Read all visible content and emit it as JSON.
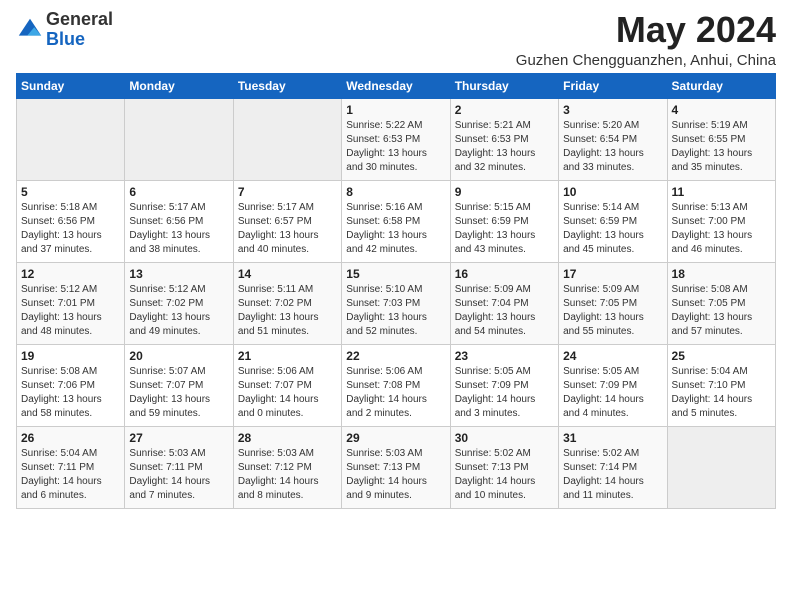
{
  "logo": {
    "general": "General",
    "blue": "Blue"
  },
  "title": "May 2024",
  "location": "Guzhen Chengguanzhen, Anhui, China",
  "days_of_week": [
    "Sunday",
    "Monday",
    "Tuesday",
    "Wednesday",
    "Thursday",
    "Friday",
    "Saturday"
  ],
  "weeks": [
    [
      {
        "day": "",
        "empty": true
      },
      {
        "day": "",
        "empty": true
      },
      {
        "day": "",
        "empty": true
      },
      {
        "day": "1",
        "sunrise": "5:22 AM",
        "sunset": "6:53 PM",
        "daylight": "13 hours and 30 minutes."
      },
      {
        "day": "2",
        "sunrise": "5:21 AM",
        "sunset": "6:53 PM",
        "daylight": "13 hours and 32 minutes."
      },
      {
        "day": "3",
        "sunrise": "5:20 AM",
        "sunset": "6:54 PM",
        "daylight": "13 hours and 33 minutes."
      },
      {
        "day": "4",
        "sunrise": "5:19 AM",
        "sunset": "6:55 PM",
        "daylight": "13 hours and 35 minutes."
      }
    ],
    [
      {
        "day": "5",
        "sunrise": "5:18 AM",
        "sunset": "6:56 PM",
        "daylight": "13 hours and 37 minutes."
      },
      {
        "day": "6",
        "sunrise": "5:17 AM",
        "sunset": "6:56 PM",
        "daylight": "13 hours and 38 minutes."
      },
      {
        "day": "7",
        "sunrise": "5:17 AM",
        "sunset": "6:57 PM",
        "daylight": "13 hours and 40 minutes."
      },
      {
        "day": "8",
        "sunrise": "5:16 AM",
        "sunset": "6:58 PM",
        "daylight": "13 hours and 42 minutes."
      },
      {
        "day": "9",
        "sunrise": "5:15 AM",
        "sunset": "6:59 PM",
        "daylight": "13 hours and 43 minutes."
      },
      {
        "day": "10",
        "sunrise": "5:14 AM",
        "sunset": "6:59 PM",
        "daylight": "13 hours and 45 minutes."
      },
      {
        "day": "11",
        "sunrise": "5:13 AM",
        "sunset": "7:00 PM",
        "daylight": "13 hours and 46 minutes."
      }
    ],
    [
      {
        "day": "12",
        "sunrise": "5:12 AM",
        "sunset": "7:01 PM",
        "daylight": "13 hours and 48 minutes."
      },
      {
        "day": "13",
        "sunrise": "5:12 AM",
        "sunset": "7:02 PM",
        "daylight": "13 hours and 49 minutes."
      },
      {
        "day": "14",
        "sunrise": "5:11 AM",
        "sunset": "7:02 PM",
        "daylight": "13 hours and 51 minutes."
      },
      {
        "day": "15",
        "sunrise": "5:10 AM",
        "sunset": "7:03 PM",
        "daylight": "13 hours and 52 minutes."
      },
      {
        "day": "16",
        "sunrise": "5:09 AM",
        "sunset": "7:04 PM",
        "daylight": "13 hours and 54 minutes."
      },
      {
        "day": "17",
        "sunrise": "5:09 AM",
        "sunset": "7:05 PM",
        "daylight": "13 hours and 55 minutes."
      },
      {
        "day": "18",
        "sunrise": "5:08 AM",
        "sunset": "7:05 PM",
        "daylight": "13 hours and 57 minutes."
      }
    ],
    [
      {
        "day": "19",
        "sunrise": "5:08 AM",
        "sunset": "7:06 PM",
        "daylight": "13 hours and 58 minutes."
      },
      {
        "day": "20",
        "sunrise": "5:07 AM",
        "sunset": "7:07 PM",
        "daylight": "13 hours and 59 minutes."
      },
      {
        "day": "21",
        "sunrise": "5:06 AM",
        "sunset": "7:07 PM",
        "daylight": "14 hours and 0 minutes."
      },
      {
        "day": "22",
        "sunrise": "5:06 AM",
        "sunset": "7:08 PM",
        "daylight": "14 hours and 2 minutes."
      },
      {
        "day": "23",
        "sunrise": "5:05 AM",
        "sunset": "7:09 PM",
        "daylight": "14 hours and 3 minutes."
      },
      {
        "day": "24",
        "sunrise": "5:05 AM",
        "sunset": "7:09 PM",
        "daylight": "14 hours and 4 minutes."
      },
      {
        "day": "25",
        "sunrise": "5:04 AM",
        "sunset": "7:10 PM",
        "daylight": "14 hours and 5 minutes."
      }
    ],
    [
      {
        "day": "26",
        "sunrise": "5:04 AM",
        "sunset": "7:11 PM",
        "daylight": "14 hours and 6 minutes."
      },
      {
        "day": "27",
        "sunrise": "5:03 AM",
        "sunset": "7:11 PM",
        "daylight": "14 hours and 7 minutes."
      },
      {
        "day": "28",
        "sunrise": "5:03 AM",
        "sunset": "7:12 PM",
        "daylight": "14 hours and 8 minutes."
      },
      {
        "day": "29",
        "sunrise": "5:03 AM",
        "sunset": "7:13 PM",
        "daylight": "14 hours and 9 minutes."
      },
      {
        "day": "30",
        "sunrise": "5:02 AM",
        "sunset": "7:13 PM",
        "daylight": "14 hours and 10 minutes."
      },
      {
        "day": "31",
        "sunrise": "5:02 AM",
        "sunset": "7:14 PM",
        "daylight": "14 hours and 11 minutes."
      },
      {
        "day": "",
        "empty": true
      }
    ]
  ]
}
